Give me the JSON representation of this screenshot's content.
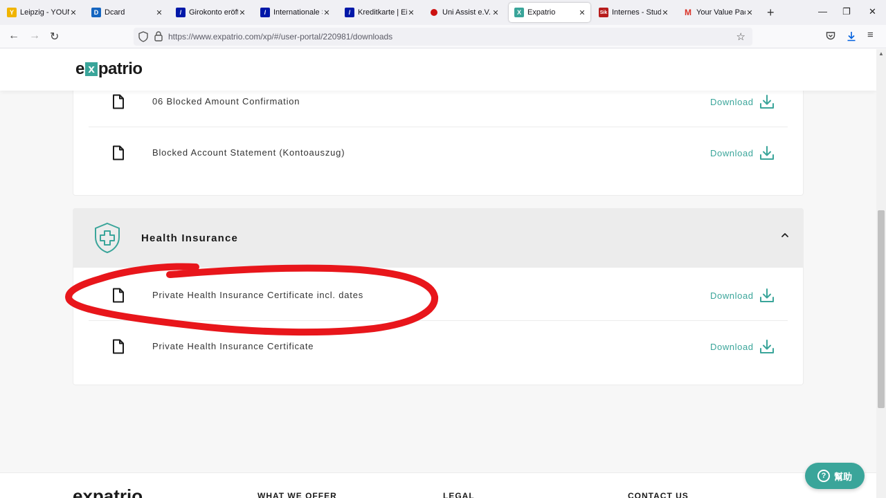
{
  "browser": {
    "tabs": [
      {
        "title": "Leipzig - YOUN",
        "icon": "leipzig-favicon",
        "color": "#f0b400"
      },
      {
        "title": "Dcard",
        "icon": "dcard-favicon",
        "color": "#1565c0"
      },
      {
        "title": "Girokonto eröff",
        "icon": "deutsche-bank-favicon",
        "color": "#0018a8"
      },
      {
        "title": "Internationale S",
        "icon": "deutsche-bank-favicon",
        "color": "#0018a8"
      },
      {
        "title": "Kreditkarte | Ein",
        "icon": "deutsche-bank-favicon",
        "color": "#0018a8"
      },
      {
        "title": "Uni Assist e.V. C",
        "icon": "uni-assist-favicon",
        "color": "#cc1111"
      },
      {
        "title": "Expatrio",
        "icon": "expatrio-favicon",
        "color": "#3aa59a"
      },
      {
        "title": "Internes - Studi",
        "icon": "sik-favicon",
        "color": "#b71c1c"
      },
      {
        "title": "Your Value Pack",
        "icon": "gmail-favicon",
        "color": "#d93025"
      }
    ],
    "url": "https://www.expatrio.com/xp/#/user-portal/220981/downloads"
  },
  "site": {
    "logo": {
      "pre": "e",
      "x": "x",
      "post": "patrio"
    }
  },
  "blocked_documents": [
    {
      "label": "06 Blocked Amount Confirmation",
      "action": "Download"
    },
    {
      "label": "Blocked Account Statement (Kontoauszug)",
      "action": "Download"
    }
  ],
  "health_section": {
    "title": "Health Insurance",
    "expanded": true,
    "documents": [
      {
        "label": "Private Health Insurance Certificate incl. dates",
        "action": "Download"
      },
      {
        "label": "Private Health Insurance Certificate",
        "action": "Download"
      }
    ]
  },
  "footer": {
    "logo": "expatrio",
    "columns": [
      "WHAT WE OFFER",
      "LEGAL",
      "CONTACT US"
    ]
  },
  "help_button": {
    "label": "幫助"
  },
  "colors": {
    "accent": "#3aa59a",
    "annotation": "#e8161b"
  }
}
